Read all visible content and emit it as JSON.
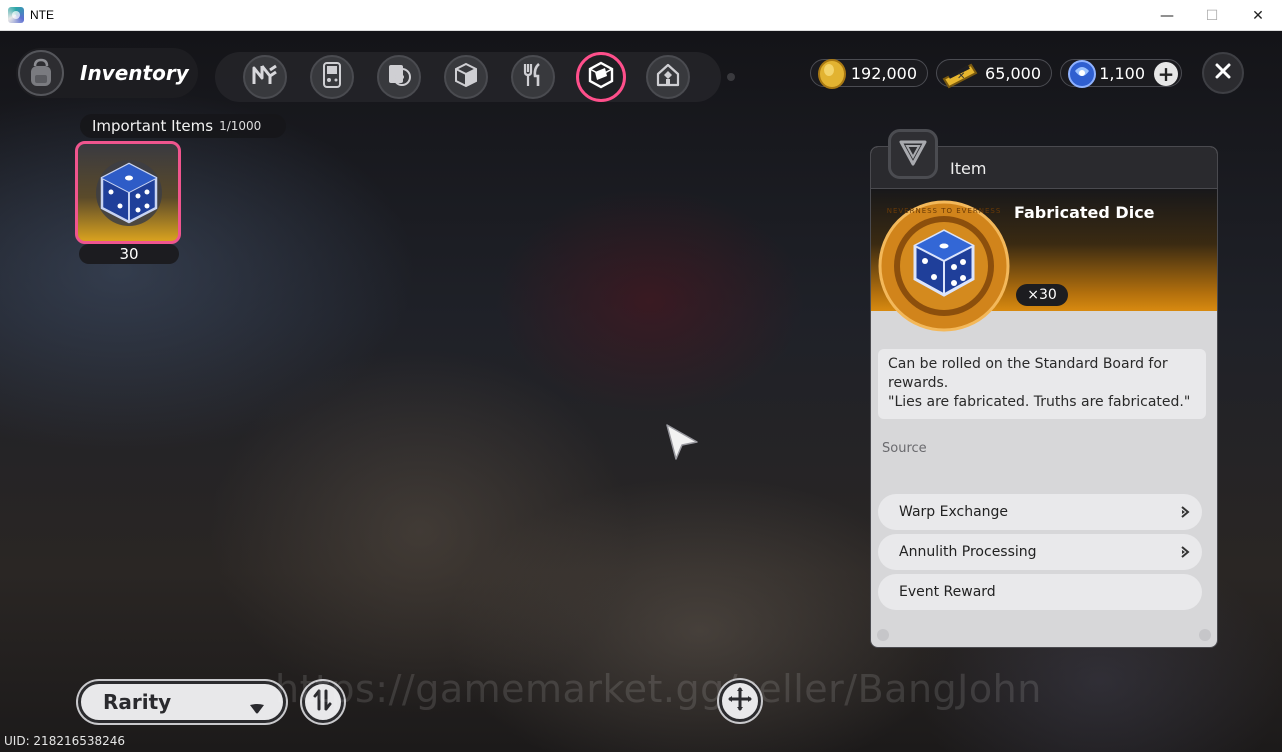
{
  "window": {
    "title": "NTE",
    "controls": {
      "minimize": "—",
      "maximize": "☐",
      "close": "✕"
    }
  },
  "header": {
    "inventory_label": "Inventory",
    "tabs": [
      {
        "name": "tab-nte",
        "icon": "nte-logo-icon"
      },
      {
        "name": "tab-gadget",
        "icon": "handheld-icon"
      },
      {
        "name": "tab-records",
        "icon": "record-icon"
      },
      {
        "name": "tab-materials",
        "icon": "cube-icon"
      },
      {
        "name": "tab-food",
        "icon": "utensils-icon"
      },
      {
        "name": "tab-important",
        "icon": "important-items-icon",
        "active": true
      },
      {
        "name": "tab-home",
        "icon": "house-icon"
      }
    ],
    "currencies": [
      {
        "name": "gold-coin",
        "value": "192,000"
      },
      {
        "name": "ticket",
        "value": "65,000"
      },
      {
        "name": "annulith",
        "value": "1,100"
      }
    ]
  },
  "section": {
    "title": "Important Items",
    "count": "1/1000"
  },
  "items": [
    {
      "name": "Fabricated Dice",
      "quantity": "30",
      "selected": true,
      "frame_color": "#f0558e"
    }
  ],
  "detail": {
    "header": "Item",
    "name": "Fabricated Dice",
    "quantity": "×30",
    "ring_text": "NEVERNESS TO EVERNESS",
    "description_line1": "Can be rolled on the Standard Board for rewards.",
    "description_line2": "\"Lies are fabricated. Truths are fabricated.\"",
    "source_label": "Source",
    "sources": [
      {
        "label": "Warp Exchange",
        "navigable": true
      },
      {
        "label": "Annulith Processing",
        "navigable": true
      },
      {
        "label": "Event Reward",
        "navigable": false
      }
    ]
  },
  "footer": {
    "sort_label": "Rarity",
    "watermark": "https://gamemarket.gg/seller/BangJohn",
    "uid": "UID: 218216538246"
  },
  "colors": {
    "accent_pink": "#f0558e",
    "gold": "#d88a10",
    "panel_bg": "#d7d7d9"
  }
}
